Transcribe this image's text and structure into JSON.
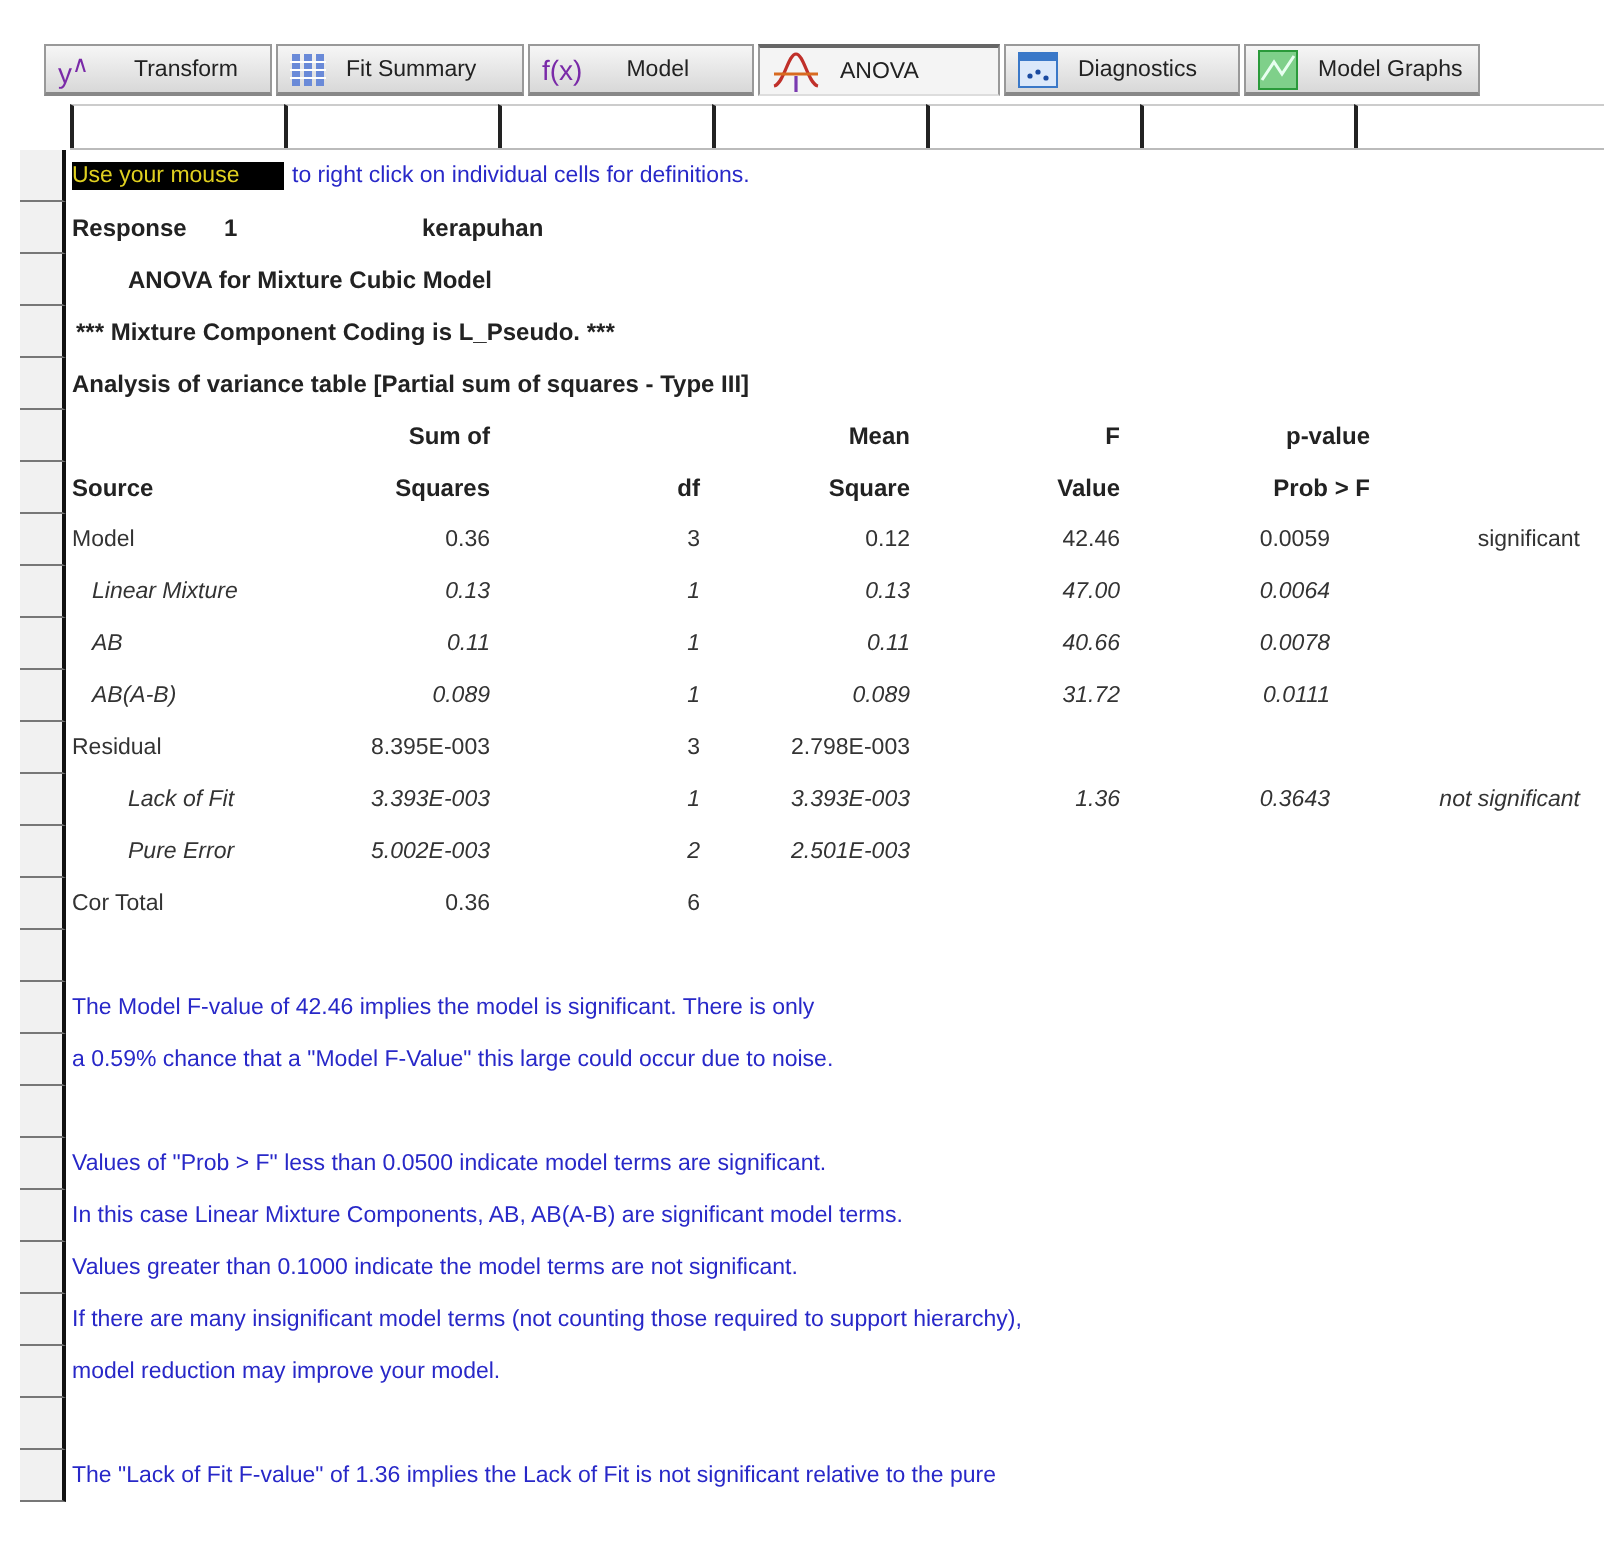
{
  "tabs": [
    {
      "label": "Transform",
      "kind": "text",
      "icon_text": "y$^{∧}$",
      "selected": false
    },
    {
      "label": "Fit Summary",
      "kind": "grid",
      "selected": false
    },
    {
      "label": "Model",
      "kind": "text",
      "icon_text": "f(x)",
      "selected": false
    },
    {
      "label": "ANOVA",
      "kind": "curve",
      "selected": true
    },
    {
      "label": "Diagnostics",
      "kind": "plot",
      "selected": false
    },
    {
      "label": "Model Graphs",
      "kind": "graphs",
      "selected": false
    }
  ],
  "report": {
    "hint": {
      "highlight": "Use your mouse",
      "rest": "to right click on individual cells for definitions."
    },
    "response": {
      "label": "Response",
      "number": "1",
      "name": "kerapuhan"
    },
    "title": "ANOVA for Mixture Cubic Model",
    "coding": "*** Mixture Component Coding is L_Pseudo. ***",
    "table_title": "Analysis of variance table [Partial sum of squares - Type III]",
    "table": {
      "columns": [
        {
          "bottom": "Source"
        },
        {
          "top": "Sum of",
          "bottom": "Squares"
        },
        {
          "bottom": "df"
        },
        {
          "top": "Mean",
          "bottom": "Square"
        },
        {
          "top": "F",
          "bottom": "Value"
        },
        {
          "top": "p-value",
          "bottom": "Prob > F"
        }
      ],
      "rows": [
        {
          "cells": [
            "Model",
            "0.36",
            "3",
            "0.12",
            "42.46",
            "0.0059",
            "significant"
          ],
          "children": [
            {
              "cells": [
                "Linear Mixture",
                "0.13",
                "1",
                "0.13",
                "47.00",
                "0.0064",
                ""
              ]
            },
            {
              "cells": [
                "AB",
                "0.11",
                "1",
                "0.11",
                "40.66",
                "0.0078",
                ""
              ]
            },
            {
              "cells": [
                "AB(A-B)",
                "0.089",
                "1",
                "0.089",
                "31.72",
                "0.0111",
                ""
              ]
            }
          ]
        },
        {
          "cells": [
            "Residual",
            "8.395E-003",
            "3",
            "2.798E-003",
            "",
            "",
            ""
          ],
          "children": [
            {
              "cells": [
                "Lack of Fit",
                "3.393E-003",
                "1",
                "3.393E-003",
                "1.36",
                "0.3643",
                "not significant"
              ]
            },
            {
              "cells": [
                "Pure Error",
                "5.002E-003",
                "2",
                "2.501E-003",
                "",
                "",
                ""
              ]
            }
          ]
        },
        {
          "cells": [
            "Cor Total",
            "0.36",
            "6",
            "",
            "",
            "",
            ""
          ]
        }
      ]
    },
    "notes": [
      [
        "The Model F-value of 42.46 implies the model is significant.  There is only",
        "a 0.59% chance that a \"Model F-Value\" this large could occur due to noise."
      ],
      [
        "Values of \"Prob > F\" less than 0.0500 indicate model terms are significant.",
        "In this case Linear Mixture Components, AB, AB(A-B) are significant model terms.",
        "Values greater than 0.1000 indicate the model terms are not significant.",
        "If there are many insignificant model terms (not counting those required to support hierarchy),",
        "model reduction may improve your model."
      ],
      [
        "The \"Lack of Fit F-value\" of 1.36 implies the Lack of Fit is not significant relative to the pure"
      ]
    ]
  }
}
